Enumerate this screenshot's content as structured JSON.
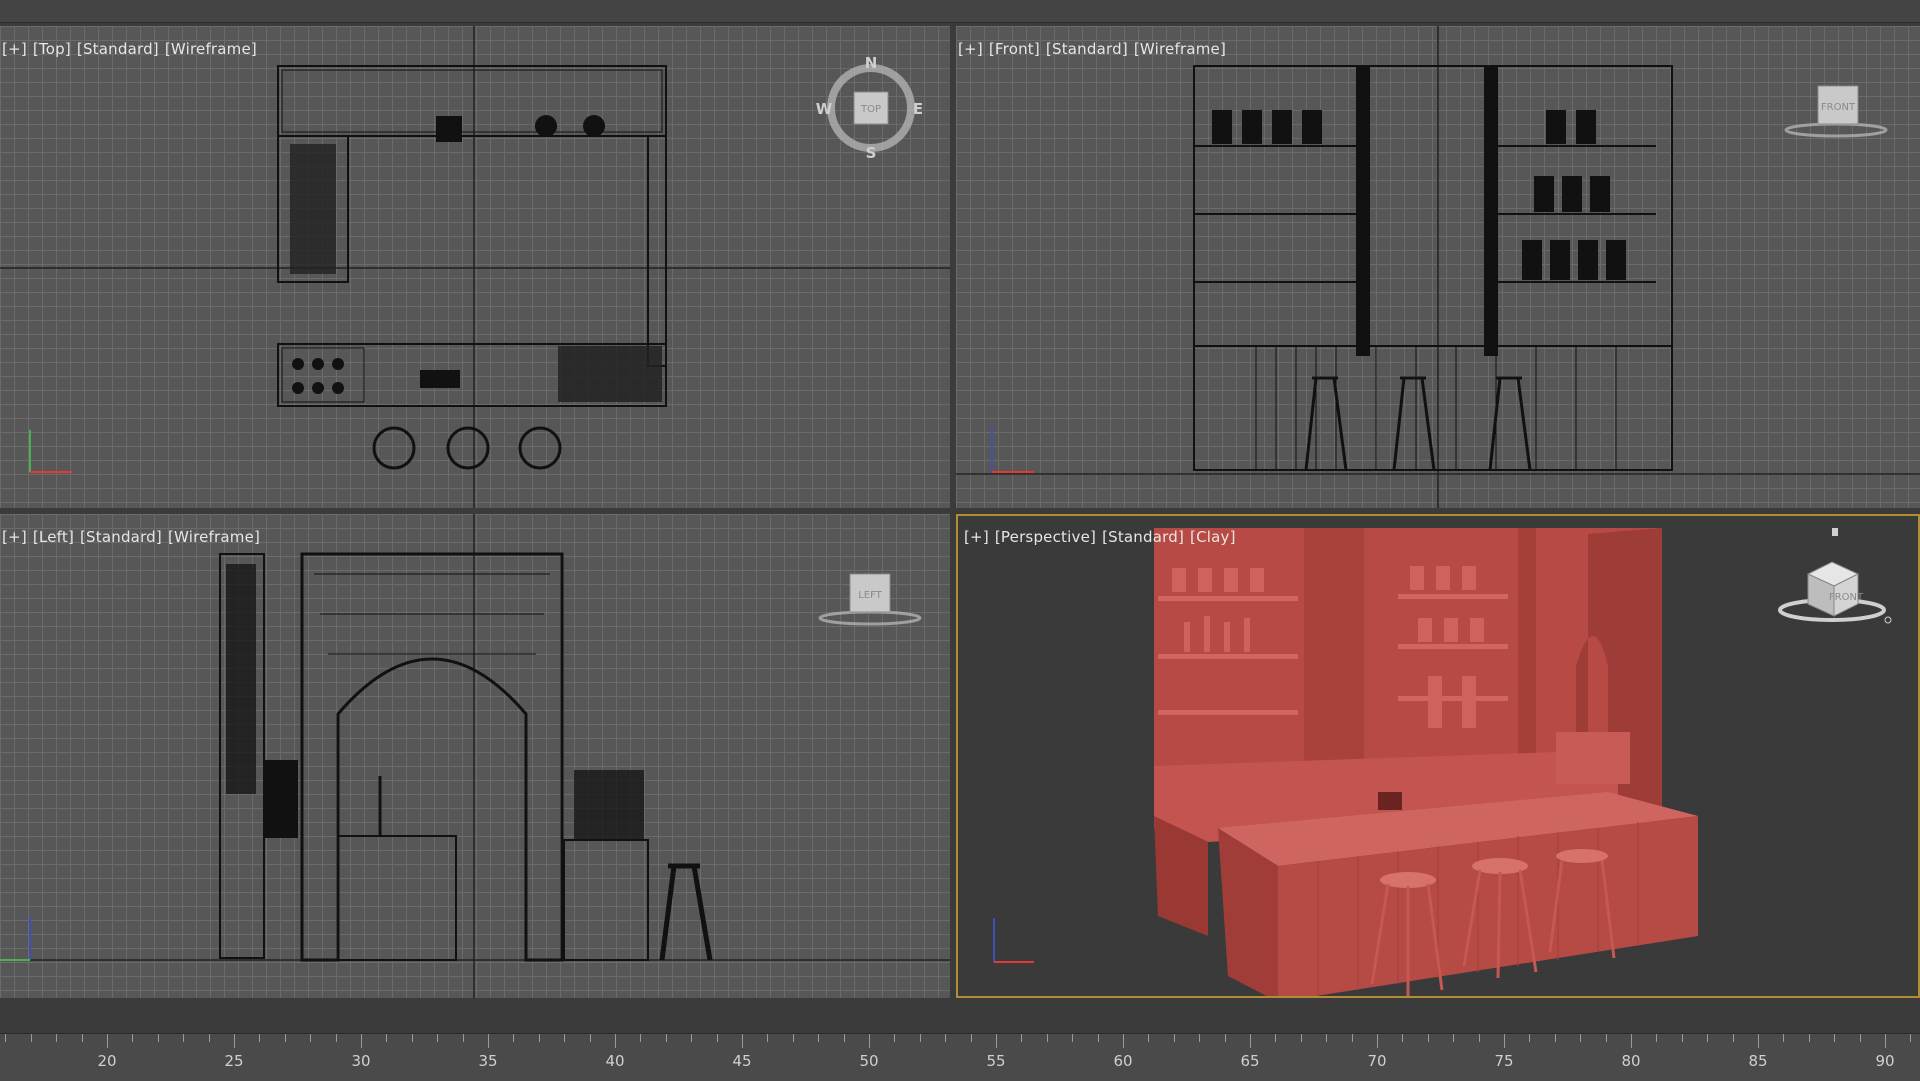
{
  "viewports": {
    "top": {
      "labels": [
        "[+]",
        "[Top]",
        "[Standard]",
        "[Wireframe]"
      ],
      "cube_label": "TOP",
      "compass": {
        "n": "N",
        "s": "S",
        "e": "E",
        "w": "W"
      }
    },
    "front": {
      "labels": [
        "[+]",
        "[Front]",
        "[Standard]",
        "[Wireframe]"
      ],
      "cube_label": "FRONT"
    },
    "left": {
      "labels": [
        "[+]",
        "[Left]",
        "[Standard]",
        "[Wireframe]"
      ],
      "cube_label": "LEFT"
    },
    "perspective": {
      "labels": [
        "[+]",
        "[Perspective]",
        "[Standard]",
        "[Clay]"
      ],
      "cube_label": "FRONT"
    }
  },
  "timeline": {
    "ticks": [
      "20",
      "25",
      "30",
      "35",
      "40",
      "45",
      "50",
      "55",
      "60",
      "65",
      "70",
      "75",
      "80",
      "85",
      "90"
    ]
  },
  "colors": {
    "viewport_bg": "#575757",
    "grid_line": "#6b6b6b",
    "wire": "#111111",
    "clay": "#c0504a",
    "active_border": "#b28d35"
  }
}
